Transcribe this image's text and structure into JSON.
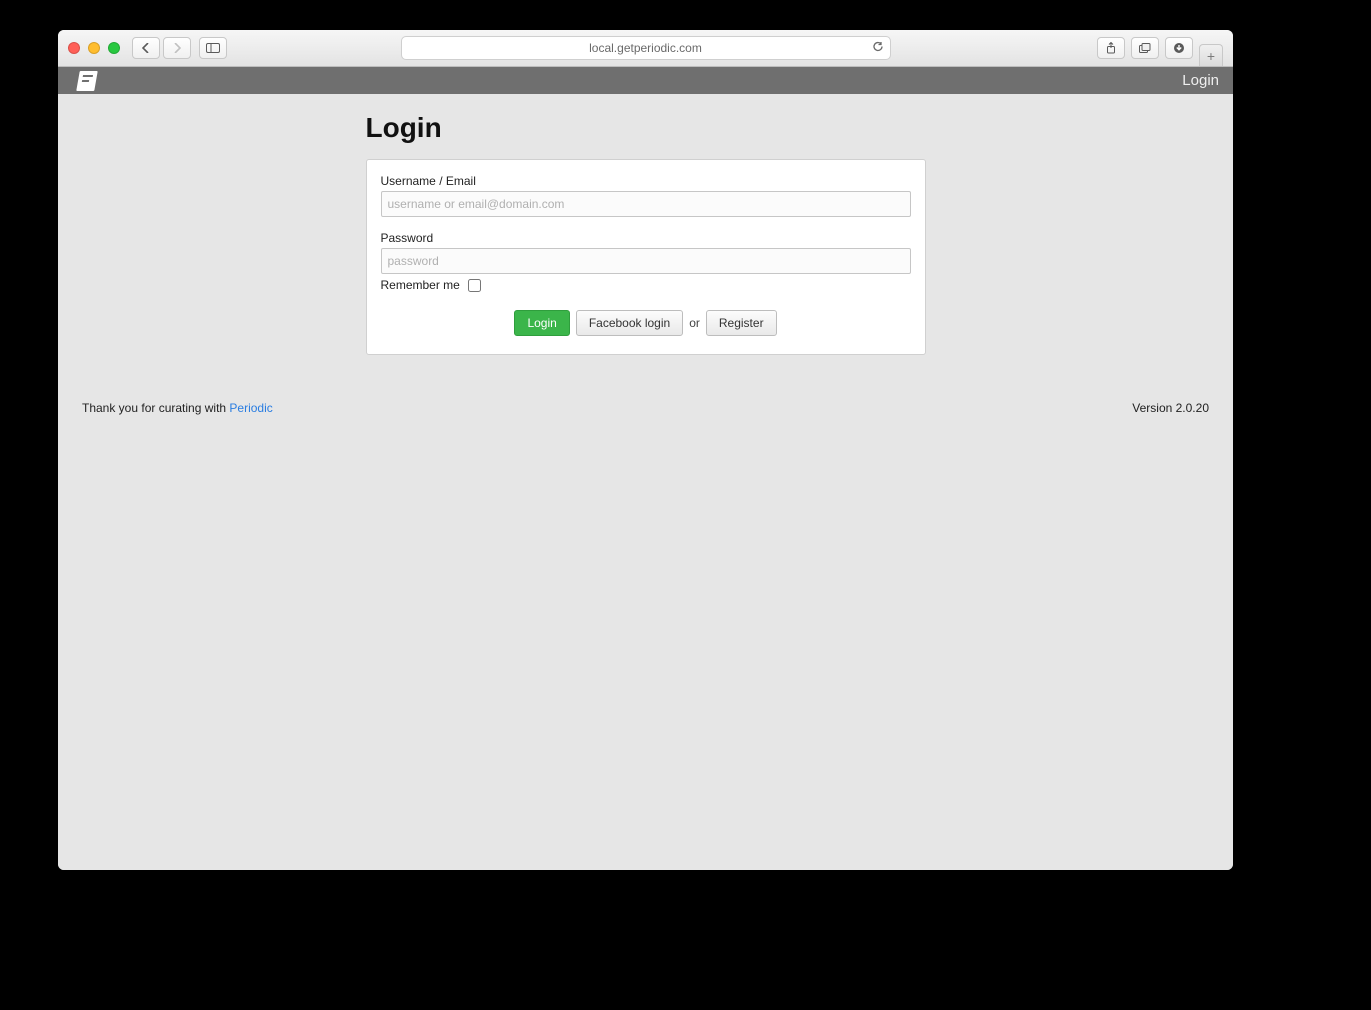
{
  "browser": {
    "url": "local.getperiodic.com"
  },
  "app_bar": {
    "login_link": "Login"
  },
  "login": {
    "title": "Login",
    "username_label": "Username / Email",
    "username_placeholder": "username or email@domain.com",
    "password_label": "Password",
    "password_placeholder": "password",
    "remember_label": "Remember me",
    "submit_label": "Login",
    "facebook_label": "Facebook login",
    "or_label": "or",
    "register_label": "Register"
  },
  "footer": {
    "thanks_prefix": "Thank you for curating with ",
    "thanks_link": "Periodic",
    "version": "Version 2.0.20"
  }
}
